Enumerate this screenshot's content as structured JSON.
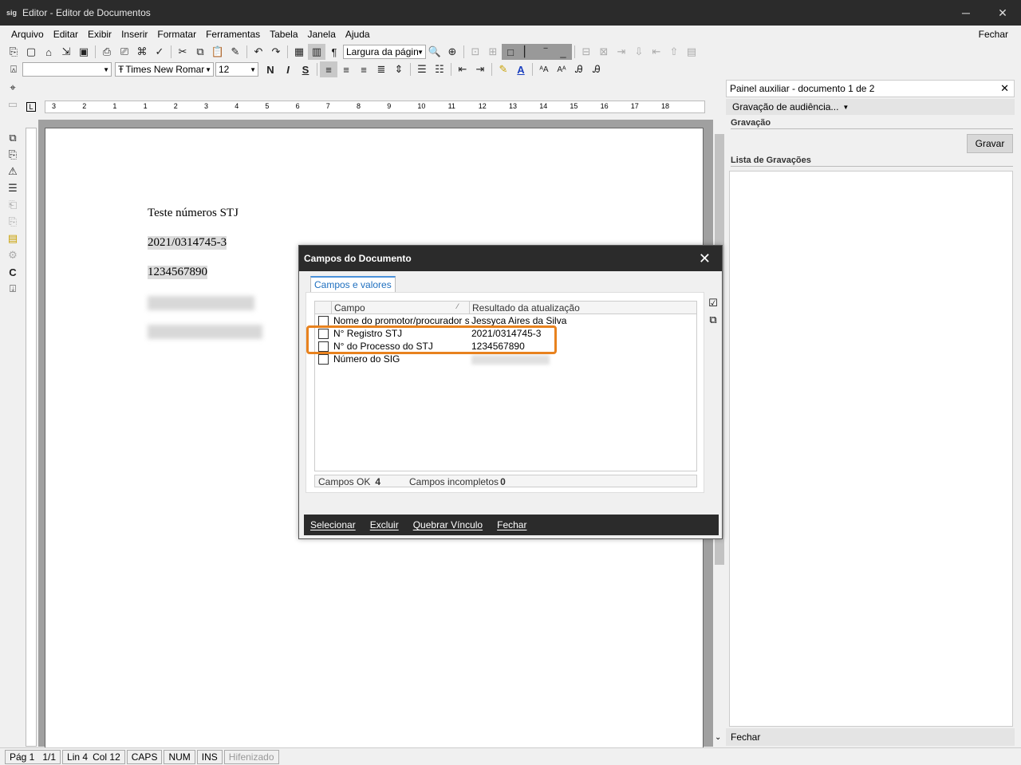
{
  "window": {
    "app_icon": "sig",
    "title": "Editor - Editor de Documentos",
    "minimize": "─",
    "close": "✕"
  },
  "menu": {
    "items": [
      "Arquivo",
      "Editar",
      "Exibir",
      "Inserir",
      "Formatar",
      "Ferramentas",
      "Tabela",
      "Janela",
      "Ajuda"
    ],
    "right": "Fechar"
  },
  "toolbar": {
    "zoom_value": "Largura da págin",
    "font_name": "Times New Romar",
    "font_size": "12",
    "style_value": "",
    "bold": "N",
    "italic": "I",
    "strike": "S"
  },
  "document": {
    "lines": [
      "Teste números STJ",
      "2021/0314745-3",
      "1234567890"
    ]
  },
  "side_panel": {
    "header": "Painel auxiliar - documento 1 de 2",
    "dropdown": "Gravação de audiência...",
    "section_record": "Gravação",
    "record_button": "Gravar",
    "section_list": "Lista de Gravações",
    "footer": "Fechar"
  },
  "dialog": {
    "title": "Campos do Documento",
    "tab": "Campos e valores",
    "columns": [
      "Campo",
      "Resultado da atualização"
    ],
    "rows": [
      {
        "field": "Nome do promotor/procurador s",
        "value": "Jessyca Aires da Silva"
      },
      {
        "field": "N° Registro STJ",
        "value": "2021/0314745-3"
      },
      {
        "field": "N° do Processo do STJ",
        "value": "1234567890"
      },
      {
        "field": "Número do SIG",
        "value": ""
      }
    ],
    "status_ok_label": "Campos OK",
    "status_ok_value": "4",
    "status_incomplete_label": "Campos incompletos",
    "status_incomplete_value": "0",
    "buttons": [
      "Selecionar",
      "Excluir",
      "Quebrar Vínculo",
      "Fechar"
    ],
    "highlight_color": "#e8821e"
  },
  "status": {
    "page": "Pág 1",
    "pages": "1/1",
    "line": "Lin 4",
    "col": "Col 12",
    "caps": "CAPS",
    "num": "NUM",
    "ins": "INS",
    "hyphen": "Hifenizado"
  },
  "ruler": {
    "ticks": [
      "3",
      "2",
      "1",
      "1",
      "2",
      "3",
      "4",
      "5",
      "6",
      "7",
      "8",
      "9",
      "10",
      "11",
      "12",
      "13",
      "14",
      "15",
      "16",
      "17",
      "18"
    ]
  }
}
